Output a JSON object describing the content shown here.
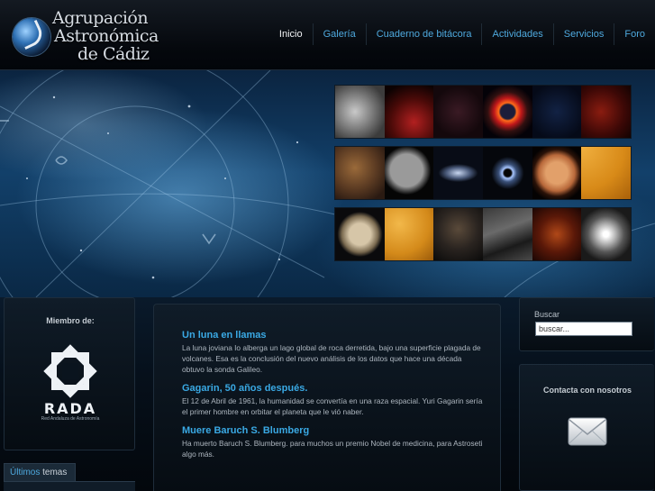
{
  "site": {
    "logo_lines": [
      "Agrupación",
      "Astronómica",
      "de Cádiz"
    ]
  },
  "nav": {
    "items": [
      {
        "label": "Inicio",
        "active": true
      },
      {
        "label": "Galería",
        "active": false
      },
      {
        "label": "Cuaderno de bitácora",
        "active": false
      },
      {
        "label": "Actividades",
        "active": false
      },
      {
        "label": "Servicios",
        "active": false
      },
      {
        "label": "Foro",
        "active": false
      }
    ]
  },
  "sidebar_left": {
    "member_label": "Miembro de:",
    "rada_name": "RADA",
    "rada_subtitle": "Red Andaluza de Astronomía",
    "tab_ultimos_prefix": "Últimos",
    "tab_ultimos_suffix": " temas"
  },
  "news": [
    {
      "title": "Un luna en llamas",
      "body": "La luna joviana Io alberga un lago global de roca derretida, bajo una superficie plagada de volcanes. Esa es la conclusión del nuevo análisis de los datos que hace una década obtuvo la sonda Galileo."
    },
    {
      "title": "Gagarin, 50 años después.",
      "body": "El 12 de Abril de 1961, la humanidad se convertía en una raza espacial. Yuri Gagarin sería el primer hombre en orbitar el planeta que le vió naber."
    },
    {
      "title": "Muere Baruch S. Blumberg",
      "body": "Ha muerto Baruch S. Blumberg. para muchos un premio Nobel de medicina, para Astroseti algo más."
    }
  ],
  "sidebar_right": {
    "search_label": "Buscar",
    "search_placeholder": "buscar...",
    "contact_label": "Contacta con nosotros"
  },
  "icons": {
    "mail": "envelope-icon",
    "rada": "rada-star-icon"
  },
  "colors": {
    "accent": "#3aa9e4",
    "nav_link": "#4ea9de",
    "background": "#02060c"
  }
}
